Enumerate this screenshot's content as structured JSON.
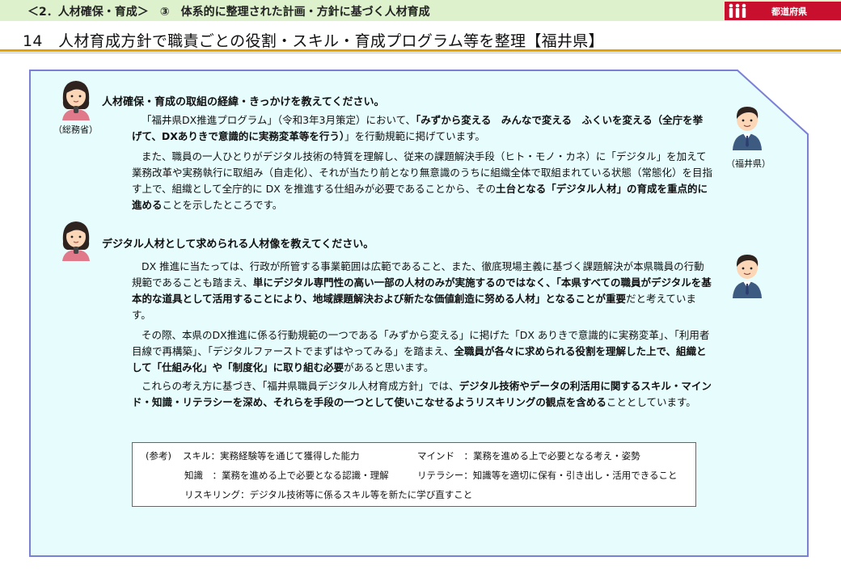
{
  "header": {
    "breadcrumb": "＜2．人材確保・育成＞　③　体系的に整理された計画・方針に基づく人材育成",
    "category_tag": "都道府県",
    "title": "14　人材育成方針で職責ごとの役割・スキル・育成プログラム等を整理【福井県】"
  },
  "speakers": {
    "ministry": "（総務省）",
    "prefecture": "（福井県）"
  },
  "qa": [
    {
      "question": "人材確保・育成の取組の経緯・きっかけを教えてください。",
      "paragraphs": [
        [
          {
            "t": "「福井県DX推進プログラム」（令和3年3月策定）において、",
            "b": false
          },
          {
            "t": "「みずから変える　みんなで変える　ふくいを変える（全庁を挙げて、DXありきで意識的に実務変革等を行う）",
            "b": true
          },
          {
            "t": "」を行動規範に掲げています。",
            "b": false
          }
        ],
        [
          {
            "t": "また、職員の一人ひとりがデジタル技術の特質を理解し、従来の課題解決手段（ヒト・モノ・カネ）に「デジタル」を加えて業務改革や実務執行に取組み（自走化）、それが当たり前となり無意識のうちに組織全体で取組まれている状態（常態化）を目指す上で、組織として全庁的に DX を推進する仕組みが必要であることから、その",
            "b": false
          },
          {
            "t": "土台となる「デジタル人材」の育成を重点的に進める",
            "b": true
          },
          {
            "t": "ことを示したところです。",
            "b": false
          }
        ]
      ]
    },
    {
      "question": "デジタル人材として求められる人材像を教えてください。",
      "paragraphs": [
        [
          {
            "t": "DX 推進に当たっては、行政が所管する事業範囲は広範であること、また、徹底現場主義に基づく課題解決が本県職員の行動規範であることも踏まえ、",
            "b": false
          },
          {
            "t": "単にデジタル専門性の高い一部の人材のみが実施するのではなく、「本県すべての職員がデジタルを基本的な道具として活用することにより、地域課題解決および新たな価値創造に努める人材」となることが重要",
            "b": true
          },
          {
            "t": "だと考えています。",
            "b": false
          }
        ],
        [
          {
            "t": "その際、本県のDX推進に係る行動規範の一つである「みずから変える」に掲げた「DX ありきで意識的に実務変革」、「利用者目線で再構築」、「デジタルファーストでまずはやってみる」を踏まえ、",
            "b": false
          },
          {
            "t": "全職員が各々に求められる役割を理解した上で、組織として「仕組み化」や「制度化」に取り組む必要",
            "b": true
          },
          {
            "t": "があると思います。",
            "b": false
          }
        ],
        [
          {
            "t": "これらの考え方に基づき、「福井県職員デジタル人材育成方針」では、",
            "b": false
          },
          {
            "t": "デジタル技術やデータの利活用に関するスキル・マインド・知識・リテラシーを深め、それらを手段の一つとして使いこなせるようリスキリングの観点を含める",
            "b": true
          },
          {
            "t": "こととしています。",
            "b": false
          }
        ]
      ]
    }
  ],
  "reference": {
    "label": "(参考)",
    "skill": "スキル：実務経験等を通じて獲得した能力",
    "mind": "マインド　：業務を進める上で必要となる考え・姿勢",
    "knowledge": "知識　：業務を進める上で必要となる認識・理解",
    "literacy": "リテラシー：知識等を適切に保有・引き出し・活用できること",
    "reskilling": "リスキリング：デジタル技術等に係るスキル等を新たに学び直すこと"
  },
  "colors": {
    "panel_fill": "#e6fcfd",
    "panel_border": "#7b7fd6",
    "header_band": "#dcf1cc",
    "accent_line": "#e8a300",
    "tag_red": "#c8102e"
  }
}
